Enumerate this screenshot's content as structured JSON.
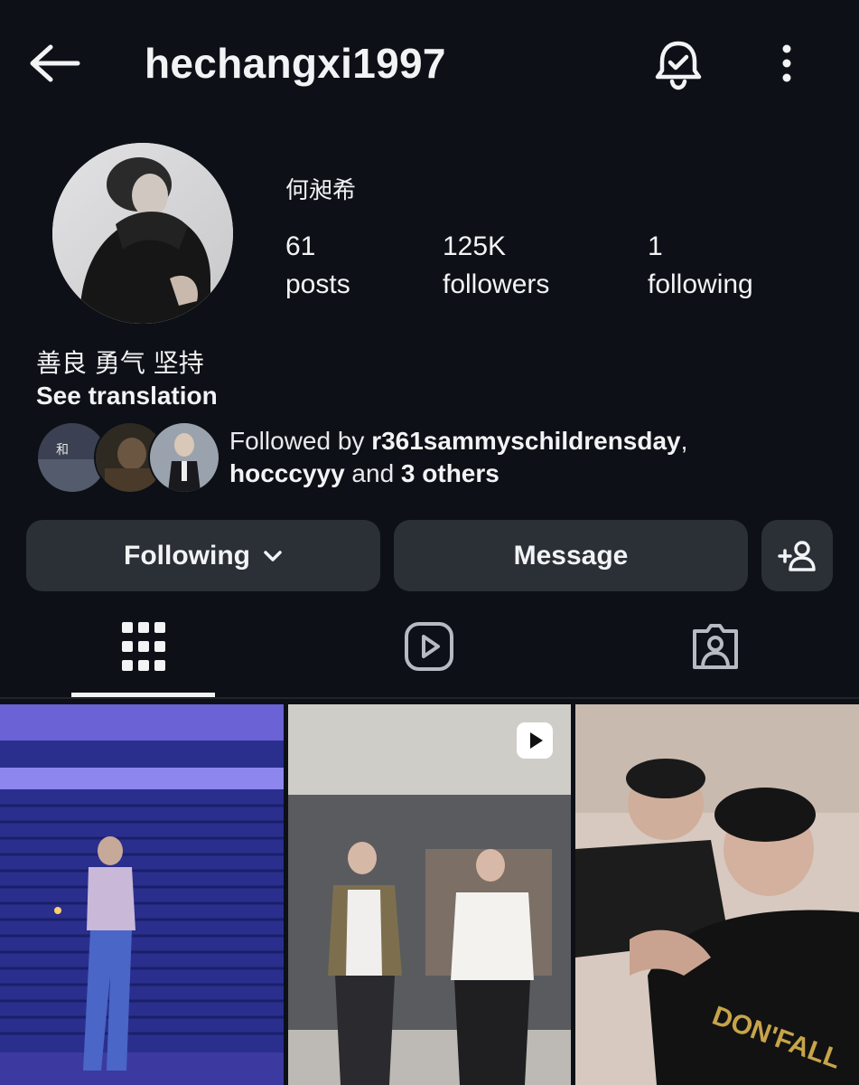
{
  "header": {
    "username": "hechangxi1997",
    "back_icon": "arrow-left-icon",
    "bell_icon": "bell-check-icon",
    "more_icon": "more-vertical-icon"
  },
  "profile": {
    "display_name": "何昶希",
    "stats": {
      "posts_count": "61",
      "posts_label": "posts",
      "followers_count": "125K",
      "followers_label": "followers",
      "following_count": "1",
      "following_label": "following"
    },
    "bio": "善良 勇气 坚持",
    "see_translation": "See translation",
    "followed_by": {
      "prefix": "Followed by ",
      "user1": "r361sammyschildrensday",
      "sep": ",",
      "user2": "hocccyyy",
      "and": " and ",
      "others": "3 others"
    }
  },
  "actions": {
    "following_label": "Following",
    "message_label": "Message",
    "add_user_icon": "add-person-icon"
  },
  "tabs": [
    {
      "name": "posts-grid",
      "icon": "grid-icon",
      "selected": true
    },
    {
      "name": "reels",
      "icon": "play-square-icon",
      "selected": false
    },
    {
      "name": "tagged",
      "icon": "person-tag-icon",
      "selected": false
    }
  ],
  "colors": {
    "background": "#0d1016",
    "button_bg": "#2b2f36",
    "text": "#f2f3f5"
  }
}
